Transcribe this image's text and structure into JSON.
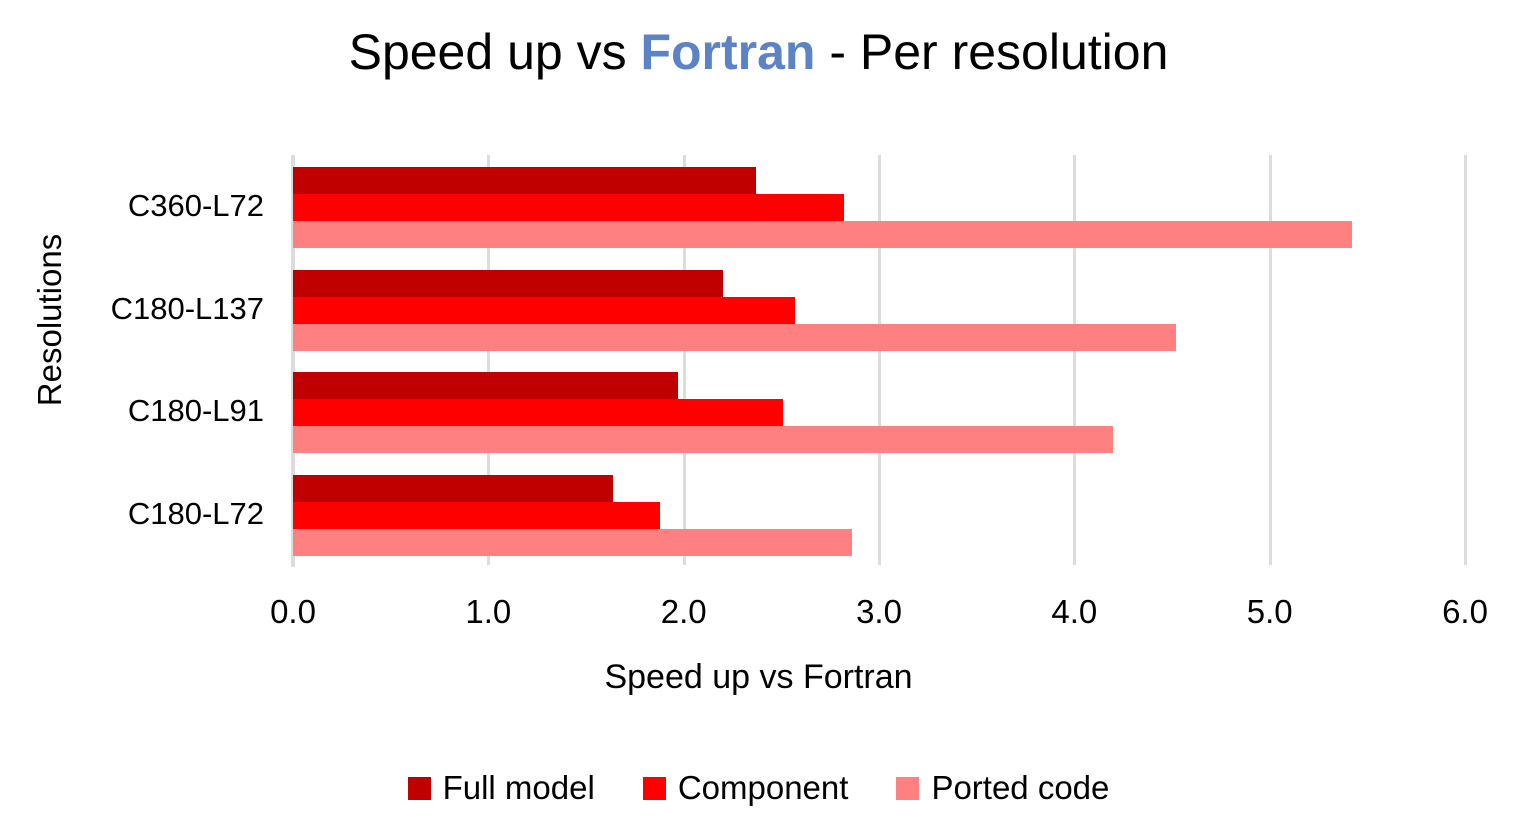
{
  "title": {
    "prefix": "Speed up vs ",
    "accent": "Fortran",
    "suffix": " - Per resolution",
    "accent_color": "#5B83C6"
  },
  "axes": {
    "x_title": "Speed up vs Fortran",
    "y_title": "Resolutions"
  },
  "chart_data": {
    "type": "bar",
    "orientation": "horizontal",
    "title": "Speed up vs Fortran - Per resolution",
    "xlabel": "Speed up vs Fortran",
    "ylabel": "Resolutions",
    "categories": [
      "C180-L72",
      "C180-L91",
      "C180-L137",
      "C360-L72"
    ],
    "category_order_top_to_bottom": [
      "C360-L72",
      "C180-L137",
      "C180-L91",
      "C180-L72"
    ],
    "series": [
      {
        "name": "Full model",
        "color": "#C00000",
        "values": [
          1.64,
          1.97,
          2.2,
          2.37
        ]
      },
      {
        "name": "Component",
        "color": "#FF0000",
        "values": [
          1.88,
          2.51,
          2.57,
          2.82
        ]
      },
      {
        "name": "Ported code",
        "color": "#FF8080",
        "values": [
          2.86,
          4.2,
          4.52,
          5.42
        ]
      }
    ],
    "xlim": [
      0.0,
      6.0
    ],
    "xticks": [
      "0.0",
      "1.0",
      "2.0",
      "3.0",
      "4.0",
      "5.0",
      "6.0"
    ],
    "xtick_values": [
      0,
      1,
      2,
      3,
      4,
      5,
      6
    ],
    "grid": "vertical",
    "legend_position": "bottom"
  }
}
